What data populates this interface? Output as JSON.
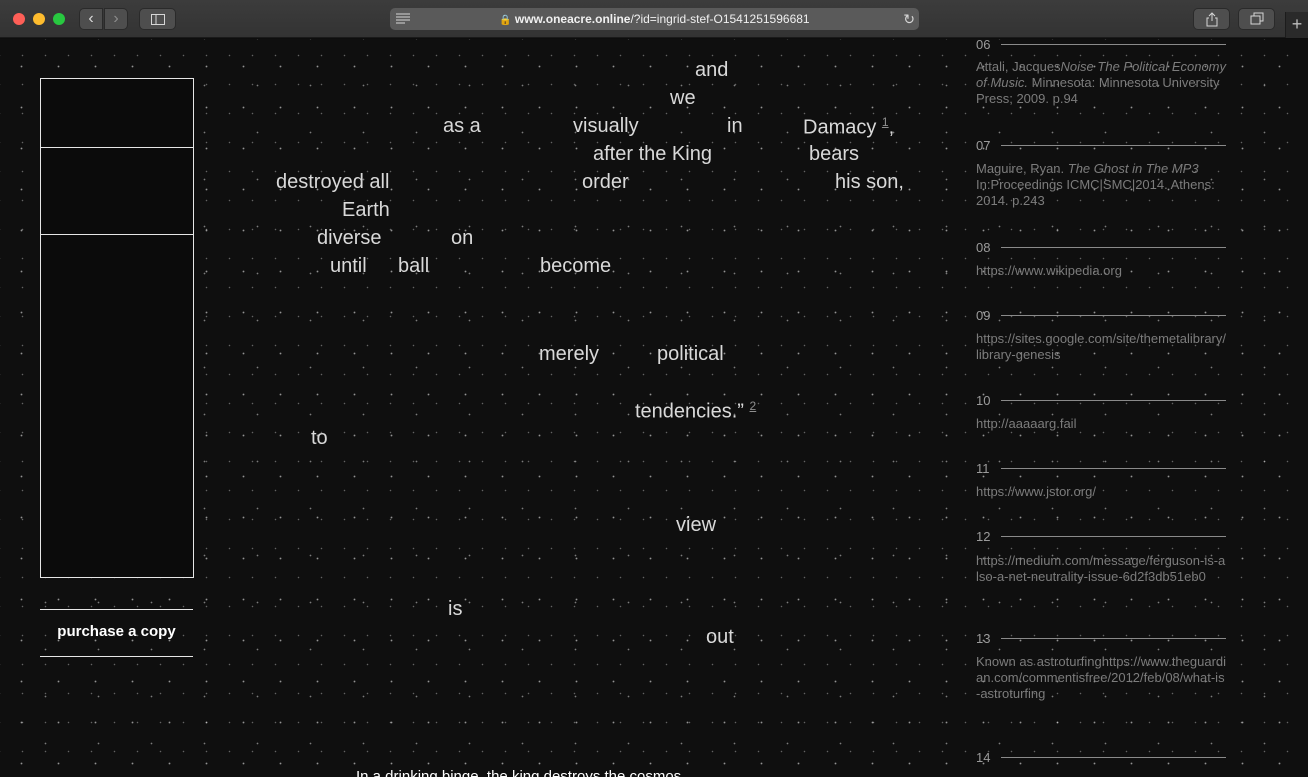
{
  "browser": {
    "url_host": "www.oneacre.online",
    "url_rest": "/?id=ingrid-stef-O1541251596681",
    "new_tab": "+"
  },
  "sidebar": {
    "purchase_label": "purchase a copy"
  },
  "poem": {
    "w1": "and",
    "w2": "we",
    "w3": "as a",
    "w4": "visually",
    "w5": "in",
    "w6": "Damacy",
    "w6_sup": "1",
    "w6_comma": ",",
    "w7": "after the King",
    "w8": "bears",
    "w9": "destroyed all",
    "w10": "order",
    "w11": "his son,",
    "w12": "Earth",
    "w13": "diverse",
    "w14": "on",
    "w15": "until",
    "w16": "ball",
    "w17": "become",
    "w18": "merely",
    "w19": "political",
    "w20": "tendencies.”",
    "w20_sup": "2",
    "w21": "to",
    "w22": "view",
    "w23": "is",
    "w24": "out",
    "bottom": "In a drinking binge, the king destroys the cosmos."
  },
  "footnotes": [
    {
      "num": "06",
      "pre": "Attali, Jacques",
      "title": "Noise The Political Economy of Music.",
      "post": " Minnesota: Minnesota University Press; 2009. p.94"
    },
    {
      "num": "07",
      "pre": "Maguire, Ryan. ",
      "title": "The Ghost in The MP3",
      "post": " In:Proceedings ICMC|SMC|2014. Athens: 2014. p.243"
    },
    {
      "num": "08",
      "text": "https://www.wikipedia.org"
    },
    {
      "num": "09",
      "text": "https://sites.google.com/site/themetalibrary/library-genesis"
    },
    {
      "num": "10",
      "text": "http://aaaaarg.fail"
    },
    {
      "num": "11",
      "text": "https://www.jstor.org/"
    },
    {
      "num": "12",
      "text": "https://medium.com/message/ferguson-is-also-a-net-neutrality-issue-6d2f3db51eb0"
    },
    {
      "num": "13",
      "text": "Known as astroturfinghttps://www.theguardian.com/commentisfree/2012/feb/08/what-is-astroturfing"
    },
    {
      "num": "14",
      "text": ""
    }
  ]
}
